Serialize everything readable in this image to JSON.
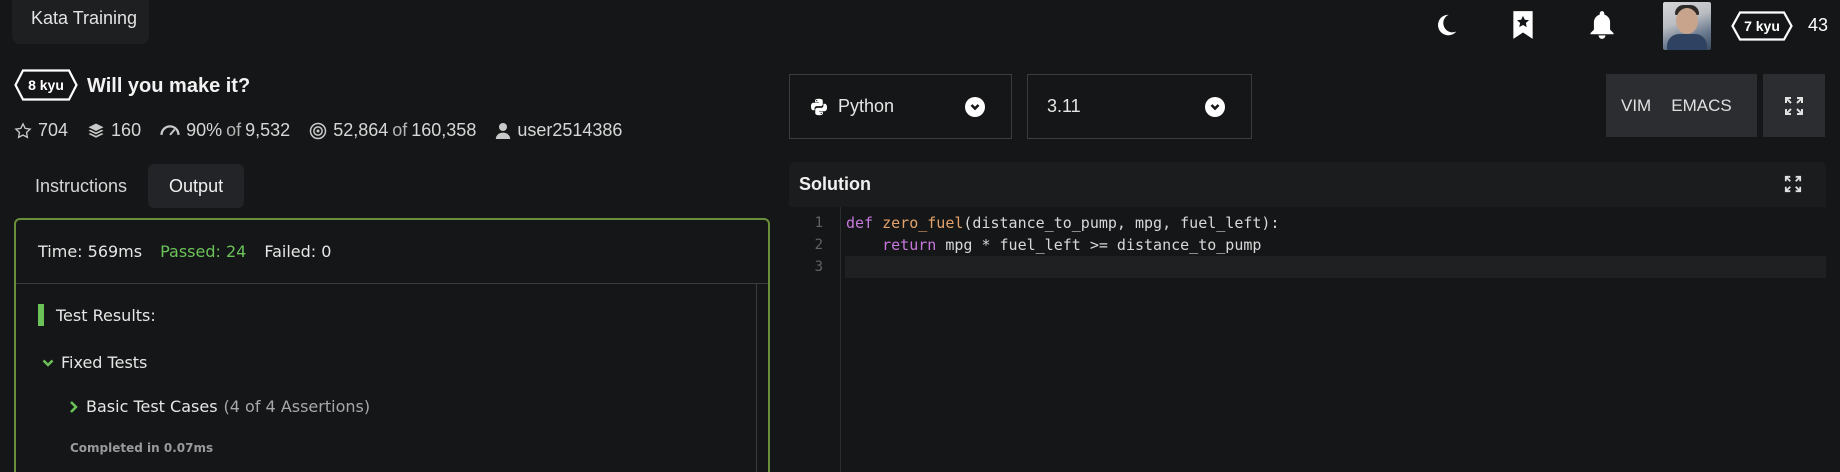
{
  "header": {
    "kata_training_label": "Kata Training",
    "user_rank": "7 kyu",
    "user_honor": "43"
  },
  "kata": {
    "rank": "8 kyu",
    "title": "Will you make it?",
    "stats": {
      "stars": "704",
      "collections": "160",
      "satisfaction_pct": "90%",
      "satisfaction_of": "of",
      "satisfaction_votes": "9,532",
      "completions": "52,864",
      "completions_of": "of",
      "attempts": "160,358",
      "author": "user2514386"
    }
  },
  "tabs": [
    {
      "label": "Instructions",
      "active": false
    },
    {
      "label": "Output",
      "active": true
    }
  ],
  "output": {
    "time": "Time: 569ms",
    "passed": "Passed: 24",
    "failed": "Failed: 0",
    "test_results": "Test Results:",
    "fixed_tests": "Fixed Tests",
    "basic_cases": "Basic Test Cases",
    "assertions": "(4 of 4 Assertions)",
    "completed": "Completed in 0.07ms"
  },
  "language_select": {
    "value": "Python"
  },
  "version_select": {
    "value": "3.11"
  },
  "modes": {
    "vim": "VIM",
    "emacs": "EMACS"
  },
  "solution": {
    "title": "Solution",
    "line_numbers": [
      "1",
      "2",
      "3"
    ],
    "code": {
      "l1_kw": "def",
      "l1_fn": "zero_fuel",
      "l1_rest": "(distance_to_pump, mpg, fuel_left):",
      "l2_indent": "    ",
      "l2_kw": "return",
      "l2_rest": " mpg * fuel_left >= distance_to_pump"
    }
  },
  "colors": {
    "background": "#151617",
    "pass_green": "#6ac259",
    "keyword": "#c678dd",
    "function": "#e5a36b"
  }
}
